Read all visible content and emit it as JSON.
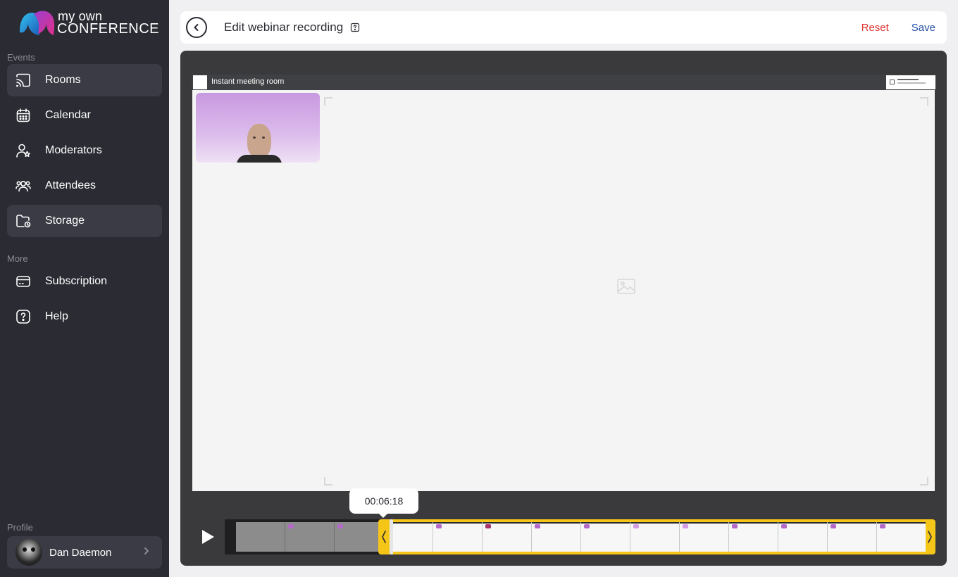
{
  "brand": {
    "line1": "my own",
    "line2": "CONFERENCE"
  },
  "sidebar": {
    "events_label": "Events",
    "more_label": "More",
    "profile_label": "Profile",
    "items": [
      {
        "label": "Rooms",
        "icon": "cast-icon",
        "active": true
      },
      {
        "label": "Calendar",
        "icon": "calendar-icon",
        "active": false
      },
      {
        "label": "Moderators",
        "icon": "moderator-icon",
        "active": false
      },
      {
        "label": "Attendees",
        "icon": "attendees-icon",
        "active": false
      },
      {
        "label": "Storage",
        "icon": "storage-folder-icon",
        "active": true
      }
    ],
    "more_items": [
      {
        "label": "Subscription",
        "icon": "credit-card-icon"
      },
      {
        "label": "Help",
        "icon": "help-icon"
      }
    ],
    "profile": {
      "name": "Dan Daemon"
    }
  },
  "topbar": {
    "title": "Edit webinar recording",
    "reset_label": "Reset",
    "save_label": "Save"
  },
  "player": {
    "room_title": "Instant meeting room",
    "timestamp": "00:06:18"
  },
  "colors": {
    "sidebar_bg": "#2a2b33",
    "active_item_bg": "#3a3b45",
    "reset": "#e0312f",
    "save": "#2450a6",
    "trim_frame": "#f5c518",
    "player_bg": "#3a3a3c"
  }
}
